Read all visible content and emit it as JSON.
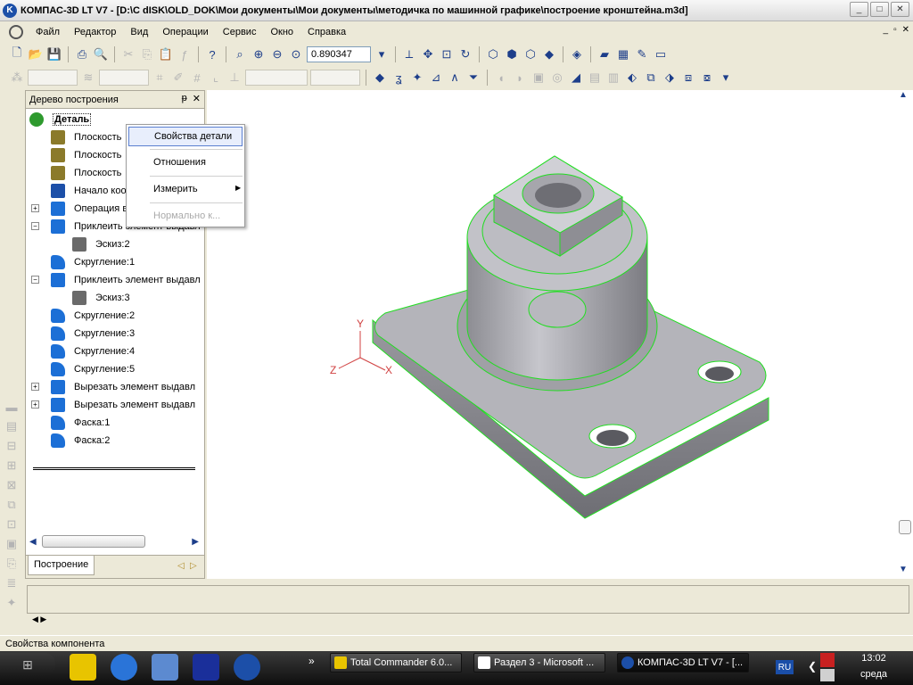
{
  "window": {
    "title": "КОМПАС-3D LT V7 - [D:\\С dISK\\OLD_DOK\\Мои документы\\Мои документы\\методичка по машинной графике\\построение кронштейна.m3d]",
    "buttons": [
      "_",
      "□",
      "✕"
    ]
  },
  "menu": {
    "items": [
      "Файл",
      "Редактор",
      "Вид",
      "Операции",
      "Сервис",
      "Окно",
      "Справка"
    ],
    "mdi_buttons": [
      "_",
      "▫",
      "✕"
    ]
  },
  "toolbar": {
    "zoom_value": "0.890347"
  },
  "tree_panel": {
    "title": "Дерево построения",
    "pin": "ᵽ",
    "close": "✕",
    "items": [
      {
        "label": "Деталь",
        "icon": "part-icon",
        "color": "#2e9a2e"
      },
      {
        "label": "Плоскость",
        "icon": "plane-icon",
        "color": "#8b7a2a"
      },
      {
        "label": "Плоскость",
        "icon": "plane-icon",
        "color": "#8b7a2a"
      },
      {
        "label": "Плоскость",
        "icon": "plane-icon",
        "color": "#8b7a2a"
      },
      {
        "label": "Начало коор",
        "icon": "origin-icon",
        "color": "#1c4fa8"
      },
      {
        "label": "Операция в",
        "icon": "operation-icon",
        "color": "#1c6fd6",
        "expander": "+"
      },
      {
        "label": "Приклеить элемент выдавл",
        "icon": "extrude-icon",
        "color": "#1c6fd6",
        "expander": "−"
      },
      {
        "label": "Эскиз:2",
        "icon": "sketch-icon",
        "color": "#6a6a6a"
      },
      {
        "label": "Скругление:1",
        "icon": "fillet-icon",
        "color": "#1c6fd6"
      },
      {
        "label": "Приклеить элемент выдавл",
        "icon": "extrude-icon",
        "color": "#1c6fd6",
        "expander": "−"
      },
      {
        "label": "Эскиз:3",
        "icon": "sketch-icon",
        "color": "#6a6a6a"
      },
      {
        "label": "Скругление:2",
        "icon": "fillet-icon",
        "color": "#1c6fd6"
      },
      {
        "label": "Скругление:3",
        "icon": "fillet-icon",
        "color": "#1c6fd6"
      },
      {
        "label": "Скругление:4",
        "icon": "fillet-icon",
        "color": "#1c6fd6"
      },
      {
        "label": "Скругление:5",
        "icon": "fillet-icon",
        "color": "#1c6fd6"
      },
      {
        "label": "Вырезать элемент выдавл",
        "icon": "cut-extrude-icon",
        "color": "#1c6fd6",
        "expander": "+"
      },
      {
        "label": "Вырезать элемент выдавл",
        "icon": "cut-extrude-icon",
        "color": "#1c6fd6",
        "expander": "+"
      },
      {
        "label": "Фаска:1",
        "icon": "chamfer-icon",
        "color": "#1c6fd6"
      },
      {
        "label": "Фаска:2",
        "icon": "chamfer-icon",
        "color": "#1c6fd6"
      }
    ],
    "tab": "Построение"
  },
  "context_menu": {
    "items": [
      {
        "label": "Свойства детали",
        "state": "selected"
      },
      {
        "label": "Отношения",
        "state": "normal"
      },
      {
        "label": "Измерить",
        "state": "submenu"
      },
      {
        "label": "Нормально к...",
        "state": "disabled"
      }
    ]
  },
  "axes": {
    "x": "X",
    "y": "Y",
    "z": "Z"
  },
  "status": {
    "text": "Свойства компонента"
  },
  "taskbar": {
    "tasks": [
      {
        "label": "Total Commander 6.0...",
        "active": false
      },
      {
        "label": "Раздел 3 - Microsoft ...",
        "active": false
      },
      {
        "label": "КОМПАС-3D LT V7 - [...",
        "active": true
      }
    ],
    "lang": "RU",
    "time": "13:02",
    "day": "среда",
    "overflow": "»"
  },
  "colors": {
    "accent": "#1c4fa8",
    "model_edge": "#22dd22",
    "model_face": "#a8a8ae",
    "axis_y": "#d04040"
  }
}
